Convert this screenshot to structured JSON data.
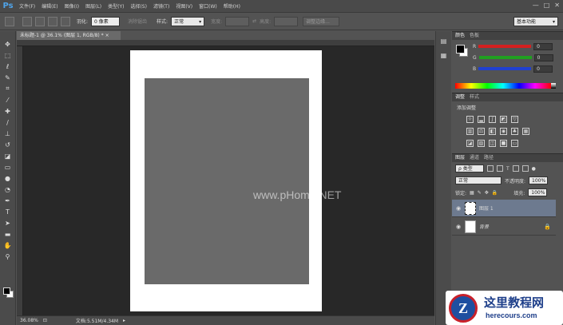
{
  "app": {
    "logo": "Ps"
  },
  "menu": [
    "文件(F)",
    "编辑(E)",
    "图像(I)",
    "图层(L)",
    "类型(Y)",
    "选择(S)",
    "滤镜(T)",
    "视图(V)",
    "窗口(W)",
    "帮助(H)"
  ],
  "window_controls": [
    "—",
    "□",
    "✕"
  ],
  "options": {
    "feather_label": "羽化:",
    "feather_value": "0 像素",
    "antialias_label": "消除锯齿",
    "style_label": "样式:",
    "style_value": "正常",
    "width_label": "宽度:",
    "height_label": "高度:",
    "refine_edge": "调整边缘..."
  },
  "workspace": "基本功能",
  "document": {
    "tab_title": "未标题-1 @ 36.1% (图层 1, RGB/8) *",
    "tab_close": "×",
    "watermark": "www.pHome.NET"
  },
  "status": {
    "zoom": "36.08%",
    "doc_info": "文档:5.51M/4.34M"
  },
  "color_panel": {
    "tabs": [
      "颜色",
      "色板"
    ],
    "rows": [
      {
        "label": "R",
        "value": "0",
        "color": "#d42020"
      },
      {
        "label": "G",
        "value": "0",
        "color": "#20a020"
      },
      {
        "label": "B",
        "value": "0",
        "color": "#2040d0"
      }
    ]
  },
  "adjustments_panel": {
    "tabs": [
      "调整",
      "样式"
    ],
    "title": "添加调整"
  },
  "layers_panel": {
    "tabs": [
      "图层",
      "通道",
      "路径"
    ],
    "kind_filter": "ρ 类型",
    "blend_mode": "正常",
    "opacity_label": "不透明度:",
    "opacity_value": "100%",
    "lock_label": "锁定:",
    "fill_label": "填充:",
    "fill_value": "100%",
    "layers": [
      {
        "name": "图层 1",
        "selected": true
      },
      {
        "name": "背景",
        "selected": false,
        "locked": true
      }
    ]
  },
  "site_badge": {
    "cn": "这里教程网",
    "en": "herecours.com",
    "mark": "Z"
  }
}
